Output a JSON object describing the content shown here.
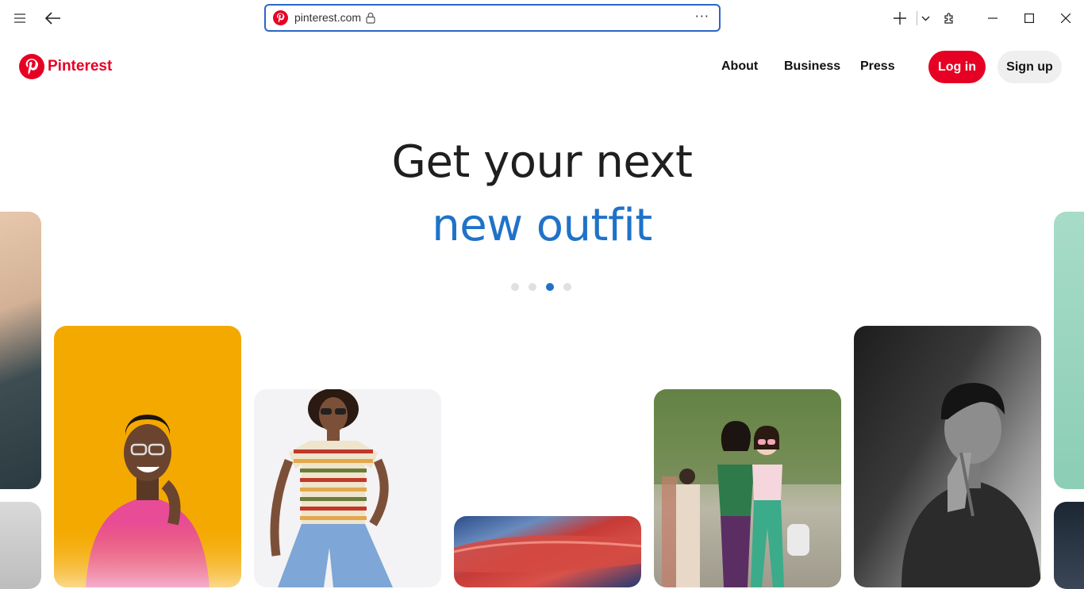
{
  "browser": {
    "url": "pinterest.com",
    "more_label": "···"
  },
  "site": {
    "logo_text": "Pinterest",
    "nav": [
      {
        "label": "About"
      },
      {
        "label": "Business"
      },
      {
        "label": "Press"
      }
    ],
    "login_label": "Log in",
    "signup_label": "Sign up"
  },
  "hero": {
    "line1": "Get your next",
    "line2": "new outfit",
    "carousel_index": 3,
    "carousel_count": 4
  },
  "colors": {
    "brand": "#e60023",
    "accent_blue": "#1f72c8"
  }
}
